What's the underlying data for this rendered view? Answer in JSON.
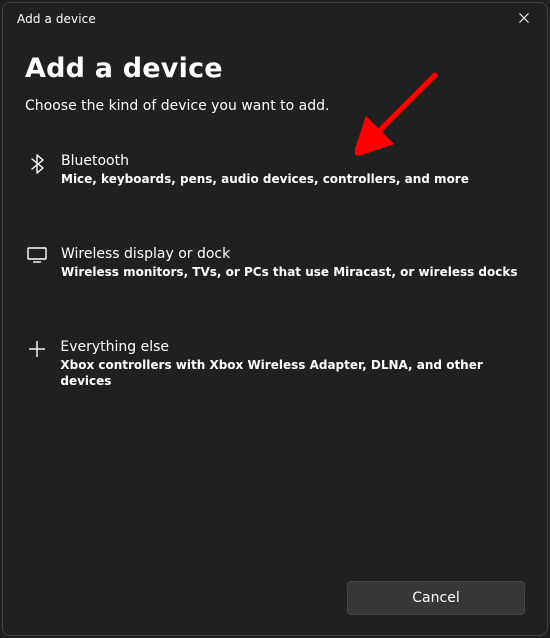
{
  "window": {
    "title": "Add a device"
  },
  "header": {
    "heading": "Add a device",
    "subheading": "Choose the kind of device you want to add."
  },
  "options": [
    {
      "icon": "bluetooth-icon",
      "title": "Bluetooth",
      "description": "Mice, keyboards, pens, audio devices, controllers, and more"
    },
    {
      "icon": "display-icon",
      "title": "Wireless display or dock",
      "description": "Wireless monitors, TVs, or PCs that use Miracast, or wireless docks"
    },
    {
      "icon": "plus-icon",
      "title": "Everything else",
      "description": "Xbox controllers with Xbox Wireless Adapter, DLNA, and other devices"
    }
  ],
  "footer": {
    "cancel_label": "Cancel"
  },
  "annotation": {
    "arrow_color": "#ff0000"
  }
}
